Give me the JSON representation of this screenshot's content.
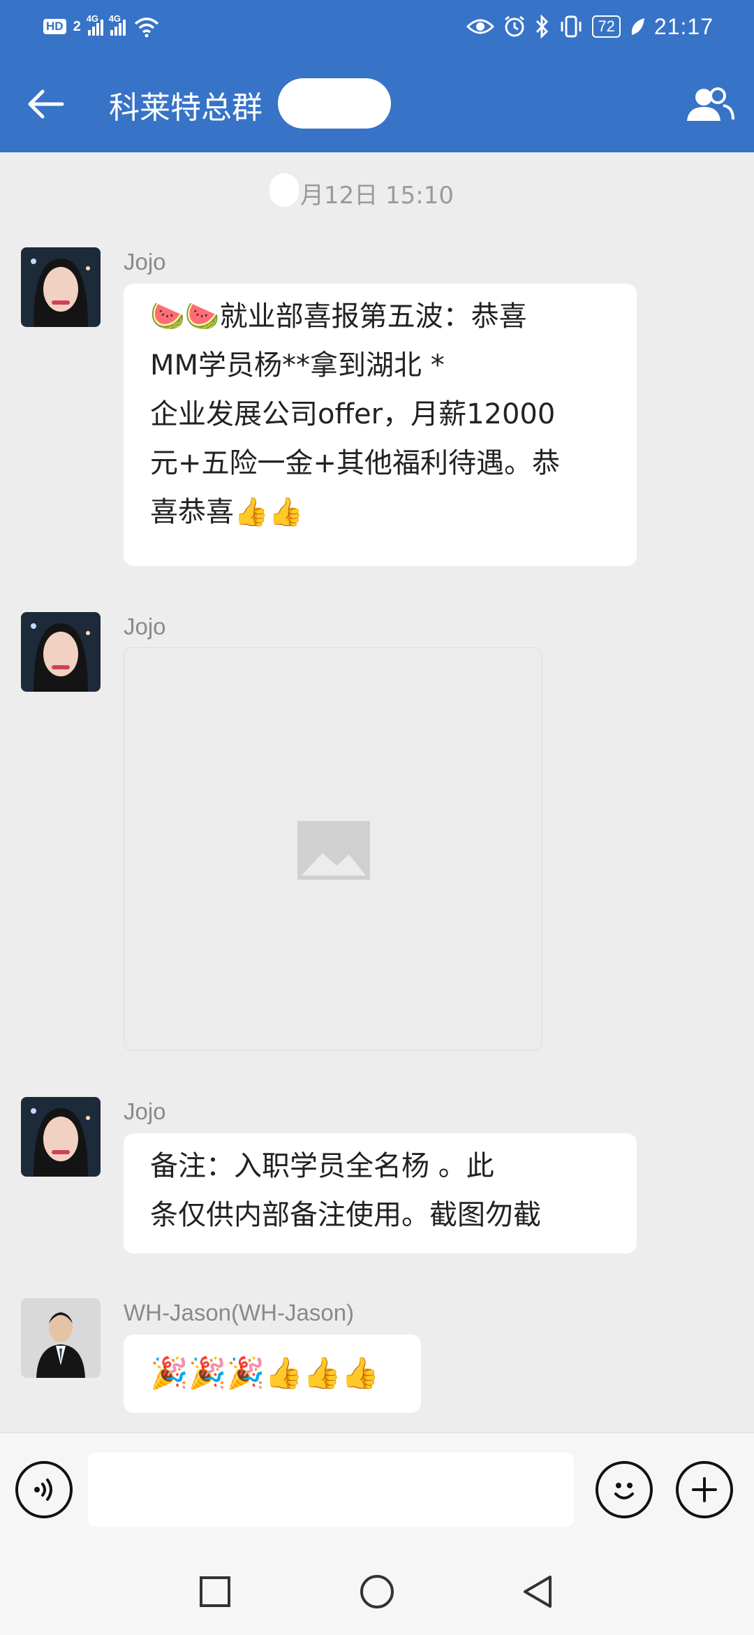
{
  "status": {
    "left": {
      "hd": "HD",
      "sim": "2",
      "net1": "4G",
      "net2": "4G"
    },
    "battery": "72",
    "time": "21:17"
  },
  "header": {
    "title": "科莱特总群"
  },
  "chat": {
    "date_separator": "月12日  15:10",
    "messages": [
      {
        "sender": "Jojo",
        "lines": [
          "🍉🍉就业部喜报第五波：恭喜",
          "      MM学员杨**拿到湖北   *",
          "企业发展公司offer，月薪12000",
          "元+五险一金+其他福利待遇。恭",
          "喜恭喜👍👍"
        ]
      },
      {
        "sender": "Jojo",
        "image_label": "image"
      },
      {
        "sender": "Jojo",
        "lines": [
          "备注：入职学员全名杨     。此",
          "条仅供内部备注使用。截图勿截"
        ]
      },
      {
        "sender": "WH-Jason(WH-Jason)",
        "lines": [
          "🎉🎉🎉👍👍👍"
        ]
      }
    ]
  },
  "input": {
    "value": "",
    "placeholder": ""
  },
  "colors": {
    "accent": "#3773c7",
    "chat_bg": "#ededed",
    "bubble": "#ffffff"
  }
}
